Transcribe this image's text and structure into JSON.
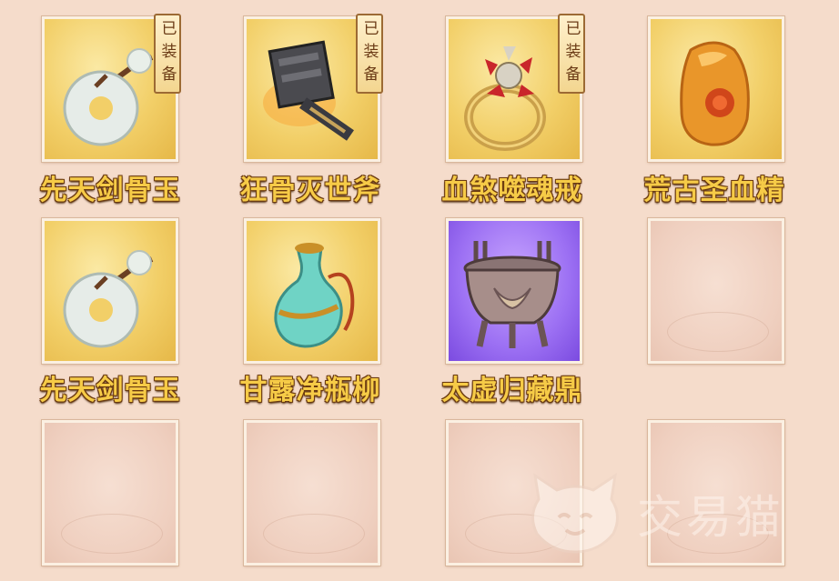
{
  "items": [
    {
      "name": "先天剑骨玉",
      "icon": "jade-disc-pendant-icon",
      "equipped": true,
      "badge": "已装备"
    },
    {
      "name": "狂骨灭世斧",
      "icon": "war-axe-icon",
      "equipped": true,
      "badge": "已装备"
    },
    {
      "name": "血煞噬魂戒",
      "icon": "ruby-ring-icon",
      "equipped": true,
      "badge": "已装备"
    },
    {
      "name": "荒古圣血精",
      "icon": "amber-stone-icon",
      "equipped": false
    },
    {
      "name": "先天剑骨玉",
      "icon": "jade-disc-pendant-icon",
      "equipped": false
    },
    {
      "name": "甘露净瓶柳",
      "icon": "jade-vase-icon",
      "equipped": false
    },
    {
      "name": "太虚归藏鼎",
      "icon": "bronze-cauldron-icon",
      "equipped": false
    }
  ],
  "empty_slots": 5,
  "watermark": "交易猫",
  "colors": {
    "rarity_gold": "#f2cf68",
    "rarity_purple": "#9c70f3",
    "label_gold": "#f6cb47"
  }
}
